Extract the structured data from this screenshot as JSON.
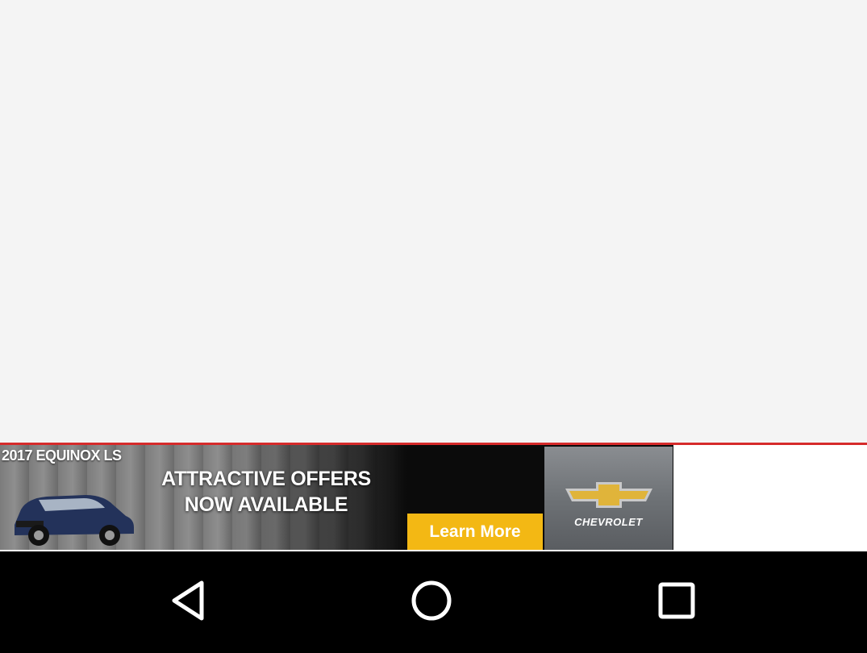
{
  "ad": {
    "model": "2017 EQUINOX LS",
    "headline_line1": "ATTRACTIVE OFFERS",
    "headline_line2": "NOW AVAILABLE",
    "cta_label": "Learn More",
    "brand": "CHEVROLET",
    "accent_color": "#f3b814",
    "divider_color": "#d62b2b"
  },
  "navbar": {
    "back": "back-icon",
    "home": "home-icon",
    "recents": "recents-icon"
  }
}
